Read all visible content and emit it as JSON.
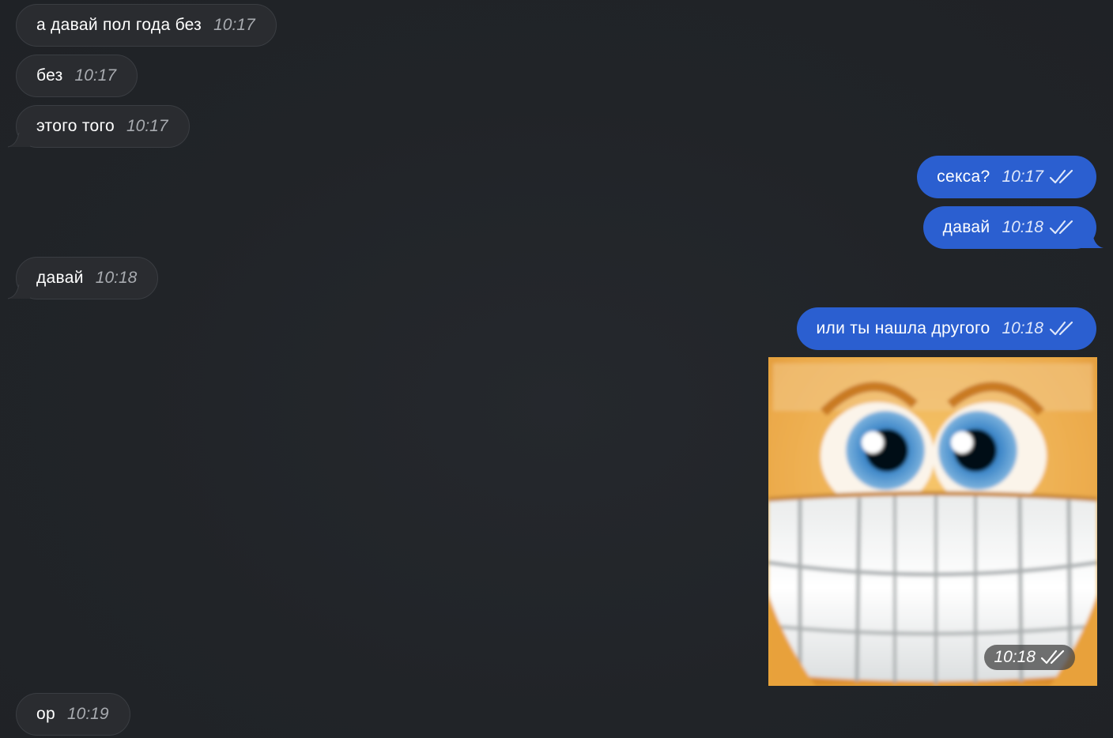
{
  "messages": [
    {
      "direction": "in",
      "text": "а давай пол года без",
      "time": "10:17"
    },
    {
      "direction": "in",
      "text": "без",
      "time": "10:17"
    },
    {
      "direction": "in",
      "text": "этого того",
      "time": "10:17"
    },
    {
      "direction": "out",
      "text": "секса?",
      "time": "10:17",
      "status": "read"
    },
    {
      "direction": "out",
      "text": "давай",
      "time": "10:18",
      "status": "read"
    },
    {
      "direction": "in",
      "text": "давай",
      "time": "10:18"
    },
    {
      "direction": "out",
      "text": "или ты нашла другого",
      "time": "10:18",
      "status": "read"
    },
    {
      "direction": "out",
      "type": "photo",
      "image": "grinning-smiley-sticker",
      "time": "10:18",
      "status": "read"
    },
    {
      "direction": "in",
      "text": "ор",
      "time": "10:19"
    }
  ],
  "colors": {
    "background": "#212428",
    "incoming_bubble": "#2a2c30",
    "outgoing_bubble": "#2b5fd0",
    "text": "#ffffff",
    "incoming_time": "#a8abb0"
  },
  "icons": {
    "read_status": "double-check-icon",
    "bubble_tail": "bubble-tail-icon"
  }
}
